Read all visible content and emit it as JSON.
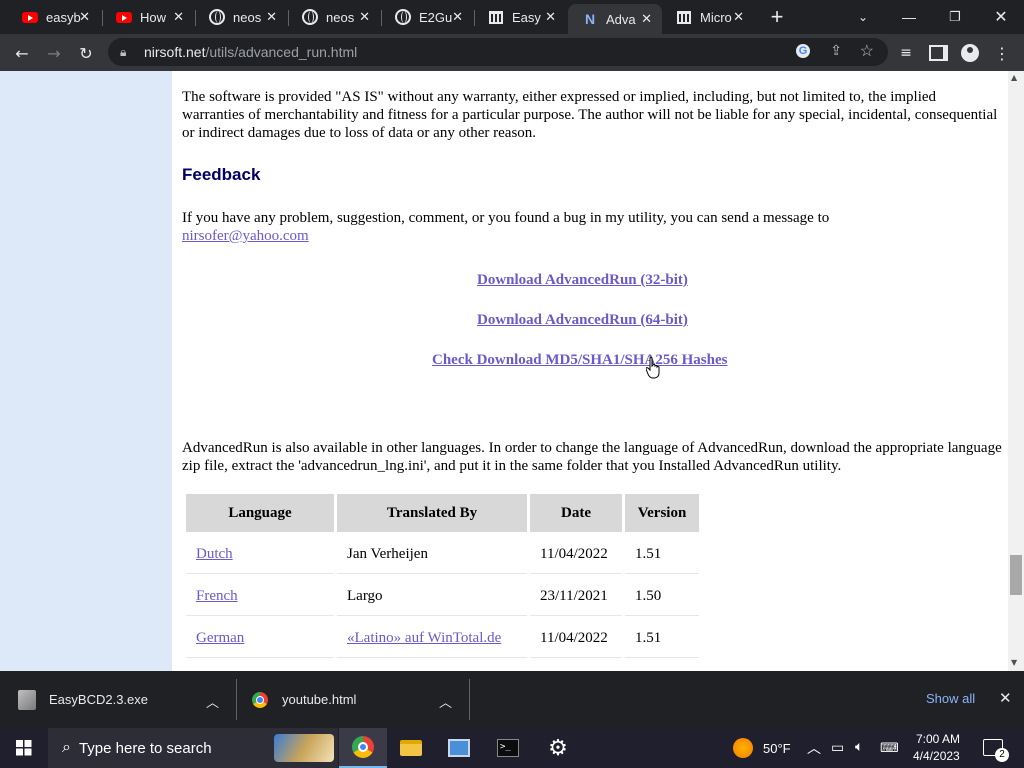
{
  "browser": {
    "tabs": [
      {
        "title": "easyb",
        "icon": "youtube-icon",
        "active": false
      },
      {
        "title": "How",
        "icon": "youtube-icon",
        "active": false
      },
      {
        "title": "neos",
        "icon": "globe-icon",
        "active": false
      },
      {
        "title": "neos",
        "icon": "globe-icon",
        "active": false
      },
      {
        "title": "E2Gu",
        "icon": "globe-icon",
        "active": false
      },
      {
        "title": "Easy",
        "icon": "bank-icon",
        "active": false
      },
      {
        "title": "Adva",
        "icon": "nirsoft-icon",
        "active": true
      },
      {
        "title": "Micro",
        "icon": "bank-icon",
        "active": false
      }
    ],
    "url_domain": "nirsoft.net",
    "url_path": "/utils/advanced_run.html"
  },
  "page": {
    "disclaimer": "The software is provided \"AS IS\" without any warranty, either expressed or implied, including, but not limited to, the implied warranties of merchantability and fitness for a particular purpose. The author will not be liable for any special, incidental, consequential or indirect damages due to loss of data or any other reason.",
    "feedback_heading": "Feedback",
    "feedback_text": "If you have any problem, suggestion, comment, or you found a bug in my utility, you can send a message to",
    "feedback_email": "nirsofer@yahoo.com",
    "download_32": "Download AdvancedRun (32-bit)",
    "download_64": "Download AdvancedRun (64-bit)",
    "check_hashes": "Check Download MD5/SHA1/SHA256 Hashes",
    "languages_text": "AdvancedRun is also available in other languages. In order to change the language of AdvancedRun, download the appropriate language zip file, extract the 'advancedrun_lng.ini', and put it in the same folder that you Installed AdvancedRun utility.",
    "table": {
      "headers": [
        "Language",
        "Translated By",
        "Date",
        "Version"
      ],
      "rows": [
        {
          "language": "Dutch",
          "translator": "Jan Verheijen",
          "translator_link": false,
          "date": "11/04/2022",
          "version": "1.51"
        },
        {
          "language": "French",
          "translator": "Largo",
          "translator_link": false,
          "date": "23/11/2021",
          "version": "1.50"
        },
        {
          "language": "German",
          "translator": "«Latino» auf WinTotal.de",
          "translator_link": true,
          "date": "11/04/2022",
          "version": "1.51"
        }
      ]
    }
  },
  "downloads": {
    "items": [
      {
        "name": "EasyBCD2.3.exe",
        "icon": "installer-icon"
      },
      {
        "name": "youtube.html",
        "icon": "chrome-icon"
      }
    ],
    "show_all": "Show all"
  },
  "taskbar": {
    "search_placeholder": "Type here to search",
    "weather": "50°F",
    "time": "7:00 AM",
    "date": "4/4/2023",
    "notification_count": "2"
  },
  "colors": {
    "link": "#6a5acd",
    "heading": "#000066",
    "sidebar": "#dde9f8",
    "chrome_dark": "#202124",
    "chrome_toolbar": "#35363a"
  }
}
